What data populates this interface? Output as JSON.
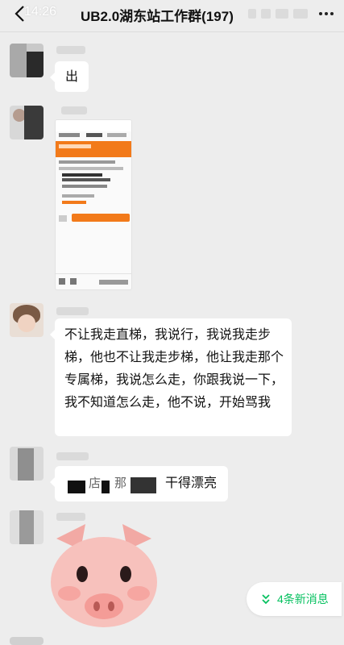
{
  "status_bar": {
    "time": "14:26"
  },
  "header": {
    "title": "UB2.0湖东站工作群(197)"
  },
  "messages": {
    "m1_text": "出",
    "m3_text": "不让我走直梯，我说行，我说我走步梯，他也不让我走步梯，他让我走那个专属梯，我说怎么走，你跟我说一下，我不知道怎么走，他不说，开始骂我",
    "m4_visible_a": "店",
    "m4_visible_b": "那",
    "m4_text": "干得漂亮"
  },
  "new_messages_pill": {
    "label": "4条新消息",
    "icon": "double-chevron-down-icon"
  },
  "colors": {
    "accent_green": "#07c160",
    "chat_bg": "#ededed",
    "bubble": "#ffffff",
    "screenshot_orange": "#f27a1a"
  },
  "icons": [
    "back-chevron-icon",
    "more-icon",
    "pig-sticker-icon",
    "double-chevron-down-icon"
  ]
}
